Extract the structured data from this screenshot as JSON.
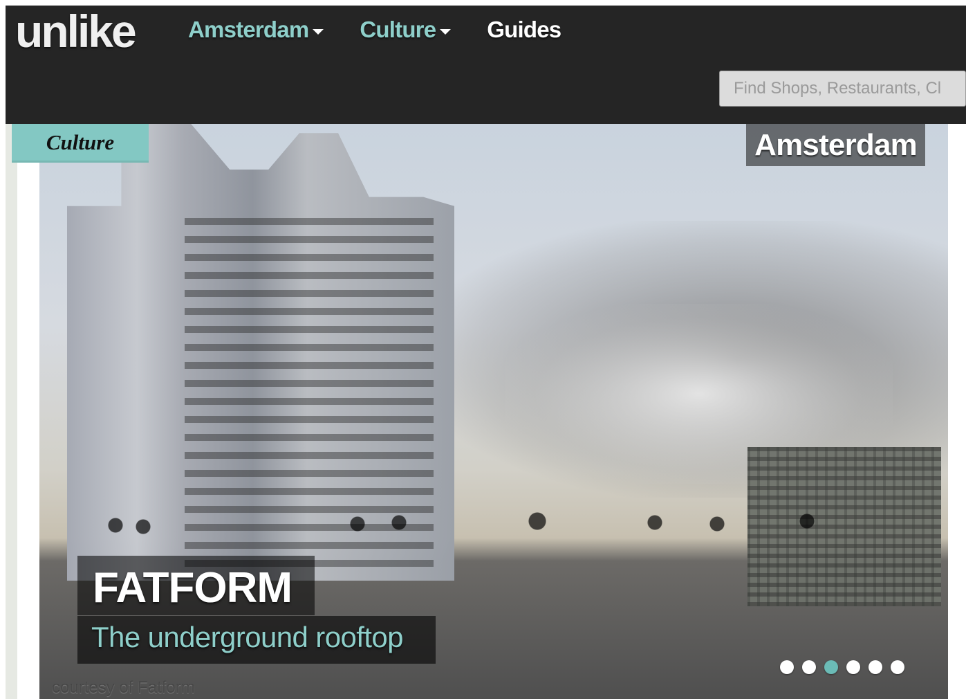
{
  "header": {
    "logo_text": "unlike",
    "nav": [
      {
        "label": "Amsterdam",
        "has_dropdown": true
      },
      {
        "label": "Culture",
        "has_dropdown": true
      },
      {
        "label": "Guides",
        "has_dropdown": false
      }
    ],
    "search": {
      "placeholder": "Find Shops, Restaurants, Cl",
      "value": ""
    }
  },
  "hero": {
    "category_tag": "Culture",
    "city_tag": "Amsterdam",
    "title": "FATFORM",
    "subtitle": "The underground rooftop",
    "photo_credit": "courtesy of Fatform",
    "carousel": {
      "total": 6,
      "active_index": 3
    }
  },
  "colors": {
    "accent": "#83c8c3",
    "nav_accent": "#8ecfca",
    "topbar": "#252525",
    "dot_active": "#6bbbb6",
    "dot_inactive": "#ffffff"
  }
}
